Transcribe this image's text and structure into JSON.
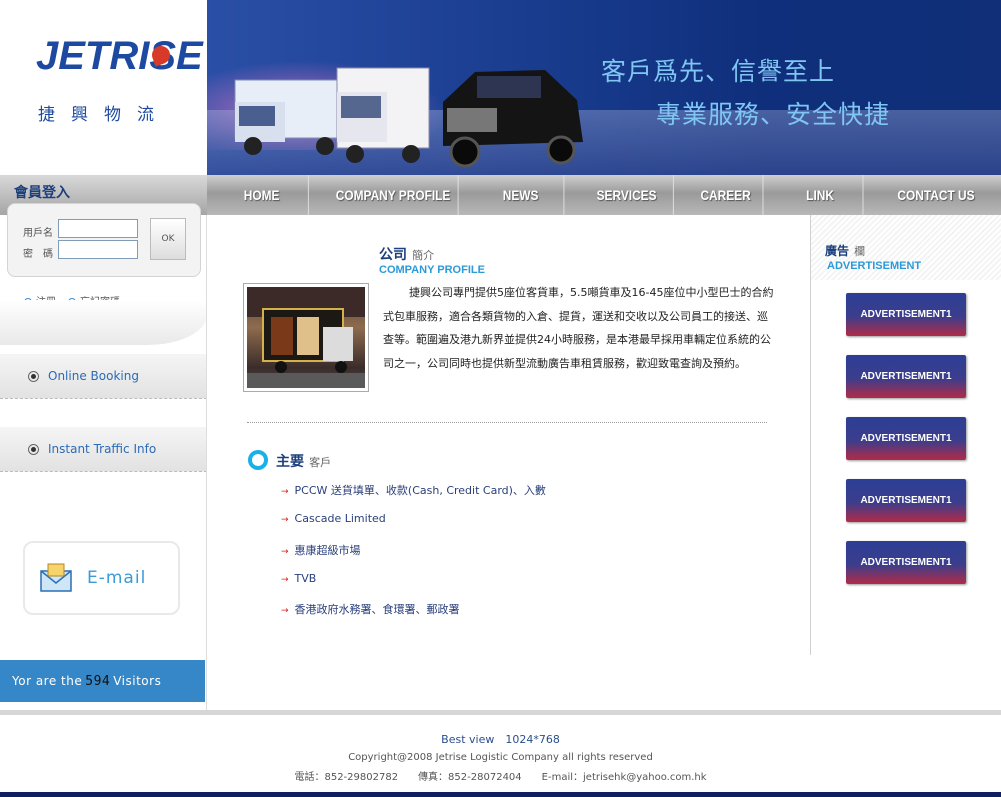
{
  "logo": {
    "word": "JETRISE",
    "chinese": "捷興物流"
  },
  "banner": {
    "slogan_line1": "客戶爲先、信譽至上",
    "slogan_line2": "專業服務、安全快捷"
  },
  "nav": [
    {
      "label": "HOME"
    },
    {
      "label": "COMPANY PROFILE"
    },
    {
      "label": "NEWS"
    },
    {
      "label": "SERVICES"
    },
    {
      "label": "CAREER"
    },
    {
      "label": "LINK"
    },
    {
      "label": "CONTACT US"
    }
  ],
  "login": {
    "title": "會員登入",
    "username_label": "用戶名",
    "password_label": "密　碼",
    "ok_label": "OK",
    "register_label": "注冊",
    "forgot_label": "忘記密碼"
  },
  "side_buttons": {
    "booking": "Online Booking",
    "traffic": "Instant Traffic Info"
  },
  "email_label": "E-mail",
  "visitors": {
    "prefix": "Yor are the",
    "count": "594",
    "suffix": "Visitors"
  },
  "profile": {
    "title": "公司",
    "title_sub": "簡介",
    "title_en": "COMPANY PROFILE",
    "text": "捷興公司專門提供5座位客貨車，5.5噸貨車及16-45座位中小型巴士的合約式包車服務，適合各類貨物的入倉、提貨，運送和交收以及公司員工的接送、巡查等。範圍遍及港九新界並提供24小時服務，是本港最早採用車輛定位系統的公司之一，公司同時也提供新型流動廣告車租賃服務，歡迎致電查詢及預約。"
  },
  "clients": {
    "title": "主要",
    "title_sub": "客戶",
    "items": [
      "PCCW 送貨填單、收款(Cash, Credit Card)、入數",
      "Cascade Limited",
      "惠康超級市場",
      "TVB",
      "香港政府水務署、食環署、郵政署"
    ]
  },
  "ads": {
    "title": "廣告",
    "title_sub": "欄",
    "title_en": "ADVERTISEMENT",
    "items": [
      "ADVERTISEMENT1",
      "ADVERTISEMENT1",
      "ADVERTISEMENT1",
      "ADVERTISEMENT1",
      "ADVERTISEMENT1"
    ]
  },
  "footer": {
    "best_view": "Best view　1024*768",
    "copyright": "Copyright@2008 Jetrise Logistic Company all rights reserved",
    "contact": "電話：852-29802782　　傳真：852-28072404　　E-mail：jetrisehk@yahoo.com.hk"
  }
}
